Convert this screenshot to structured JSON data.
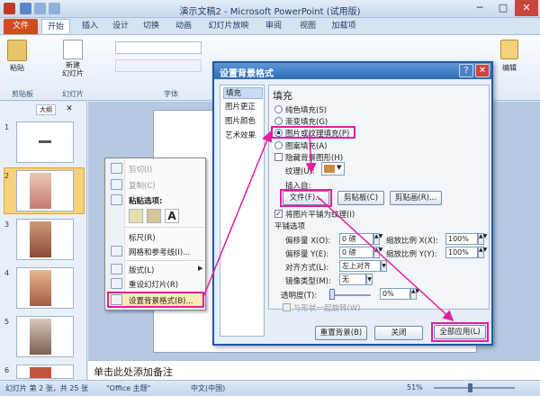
{
  "app": {
    "title": "演示文稿2 - Microsoft PowerPoint (试用版)",
    "window_controls": {
      "minimize": "─",
      "maximize": "□",
      "close": "✕"
    }
  },
  "ribbon": {
    "tabs": [
      "文件",
      "开始",
      "插入",
      "设计",
      "切换",
      "动画",
      "幻灯片放映",
      "审阅",
      "视图",
      "加载项"
    ],
    "groups": {
      "clipboard": {
        "label": "剪贴板",
        "paste": "粘贴"
      },
      "slides": {
        "label": "幻灯片",
        "new_slide": "新建\n幻灯片"
      },
      "font": {
        "label": "字体"
      },
      "edit": {
        "label": "编辑"
      }
    },
    "accent": "#d24b1c"
  },
  "slides_pane": {
    "tab": "大纲",
    "thumbs": [
      {
        "num": "1"
      },
      {
        "num": "2"
      },
      {
        "num": "3"
      },
      {
        "num": "4"
      },
      {
        "num": "5"
      },
      {
        "num": "6"
      }
    ]
  },
  "notes": {
    "placeholder": "单击此处添加备注"
  },
  "status": {
    "slide_info": "幻灯片 第 2 张，共 25 张",
    "theme": "\"Office 主题\"",
    "language": "中文(中国)",
    "zoom": "51%"
  },
  "context_menu": {
    "items": [
      {
        "label": "剪切(I)",
        "disabled": true
      },
      {
        "label": "复制(C)",
        "disabled": true
      },
      {
        "label": "粘贴选项:",
        "disabled": false
      },
      {
        "label": "标尺(R)",
        "disabled": false
      },
      {
        "label": "网格和参考线(I)...",
        "disabled": false
      },
      {
        "label": "版式(L)",
        "disabled": false
      },
      {
        "label": "重设幻灯片(R)",
        "disabled": false
      },
      {
        "label": "设置背景格式(B)...",
        "disabled": false
      }
    ],
    "paste_icons": [
      "A"
    ]
  },
  "dialog": {
    "title": "设置背景格式",
    "help": "?",
    "close": "✕",
    "nav": [
      "填充",
      "图片更正",
      "图片颜色",
      "艺术效果"
    ],
    "section_title": "填充",
    "fill_options": [
      "纯色填充(S)",
      "渐变填充(G)",
      "图片或纹理填充(P)",
      "图案填充(A)"
    ],
    "hide_bg": "隐藏背景图形(H)",
    "texture_label": "纹理(U):",
    "insert_from": "插入自:",
    "buttons_insert": [
      "文件(F)...",
      "剪贴板(C)",
      "剪贴画(R)..."
    ],
    "tile_checkbox": "将图片平铺为纹理(I)",
    "tile_options": "平铺选项",
    "offset_x_label": "偏移量 X(O):",
    "offset_x_value": "0 磅",
    "offset_y_label": "偏移量 Y(E):",
    "offset_y_value": "0 磅",
    "scale_x_label": "缩放比例 X(X):",
    "scale_x_value": "100%",
    "scale_y_label": "缩放比例 Y(Y):",
    "scale_y_value": "100%",
    "align_label": "对齐方式(L):",
    "align_value": "左上对齐",
    "mirror_label": "镜像类型(M):",
    "mirror_value": "无",
    "transparency_label": "透明度(T):",
    "transparency_value": "0%",
    "rotate_with": "与形状一起旋转(W)",
    "footer_buttons": [
      "重置背景(B)",
      "关闭",
      "全部应用(L)"
    ]
  },
  "annotation_color": "#e21ea0"
}
